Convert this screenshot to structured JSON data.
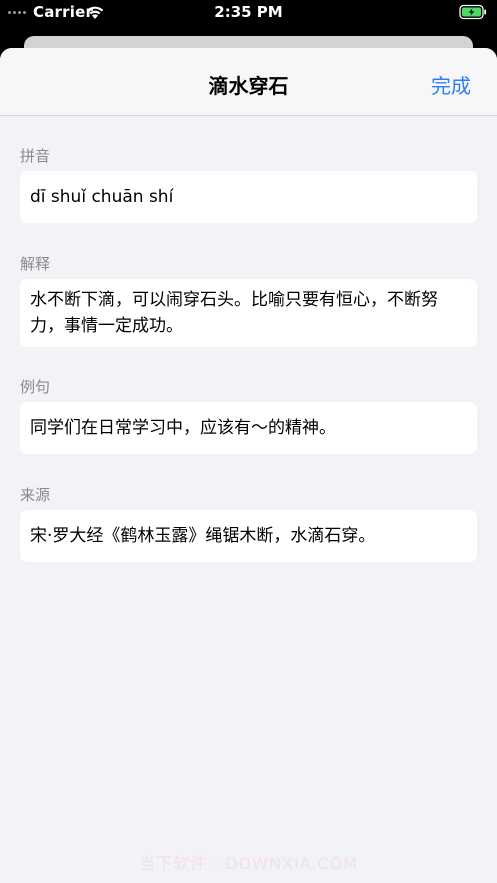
{
  "status_bar": {
    "carrier": "Carrier",
    "time": "2:35 PM"
  },
  "nav": {
    "title": "滴水穿石",
    "done_label": "完成"
  },
  "sections": [
    {
      "label": "拼音",
      "content": "dī shuǐ chuān shí"
    },
    {
      "label": "解释",
      "content": "水不断下滴，可以闹穿石头。比喻只要有恒心，不断努力，事情一定成功。"
    },
    {
      "label": "例句",
      "content": "同学们在日常学习中，应该有～的精神。"
    },
    {
      "label": "来源",
      "content": "宋·罗大经《鹤林玉露》绳锯木断，水滴石穿。"
    }
  ],
  "colors": {
    "accent": "#2f7df6",
    "background": "#f2f2f7",
    "section_label": "#8a8a8e"
  },
  "icons": {
    "signal": "signal-dots-icon",
    "wifi": "wifi-icon",
    "battery": "battery-charging-icon"
  },
  "watermark": "当下软件 · DOWNXIA.COM"
}
